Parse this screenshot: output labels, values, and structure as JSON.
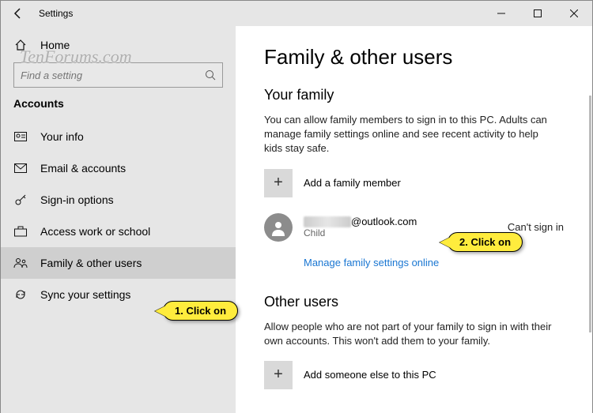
{
  "window": {
    "title": "Settings"
  },
  "watermark": "TenForums.com",
  "sidebar": {
    "home": "Home",
    "search_placeholder": "Find a setting",
    "section": "Accounts",
    "items": [
      {
        "label": "Your info"
      },
      {
        "label": "Email & accounts"
      },
      {
        "label": "Sign-in options"
      },
      {
        "label": "Access work or school"
      },
      {
        "label": "Family & other users"
      },
      {
        "label": "Sync your settings"
      }
    ]
  },
  "main": {
    "heading": "Family & other users",
    "family_heading": "Your family",
    "family_desc": "You can allow family members to sign in to this PC. Adults can manage family settings online and see recent activity to help kids stay safe.",
    "add_family": "Add a family member",
    "member": {
      "email_suffix": "@outlook.com",
      "role": "Child",
      "status": "Can't sign in"
    },
    "manage_link": "Manage family settings online",
    "other_heading": "Other users",
    "other_desc": "Allow people who are not part of your family to sign in with their own accounts. This won't add them to your family.",
    "add_other": "Add someone else to this PC"
  },
  "callouts": {
    "one": "1. Click on",
    "two": "2. Click on"
  }
}
